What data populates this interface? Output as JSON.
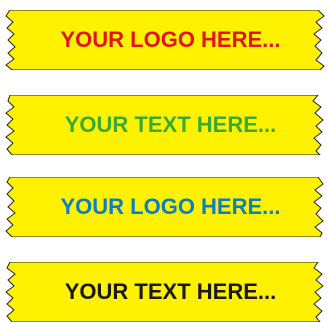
{
  "tapes": [
    {
      "text": "YOUR LOGO HERE...",
      "text_color": "#e0161d",
      "tape_color": "#fff200"
    },
    {
      "text": "YOUR TEXT HERE...",
      "text_color": "#3aaa35",
      "tape_color": "#fff200"
    },
    {
      "text": "YOUR LOGO HERE...",
      "text_color": "#0b7fc4",
      "tape_color": "#fff200"
    },
    {
      "text": "YOUR TEXT HERE...",
      "text_color": "#1a1a1a",
      "tape_color": "#fff200"
    }
  ],
  "outline_color": "#222222"
}
